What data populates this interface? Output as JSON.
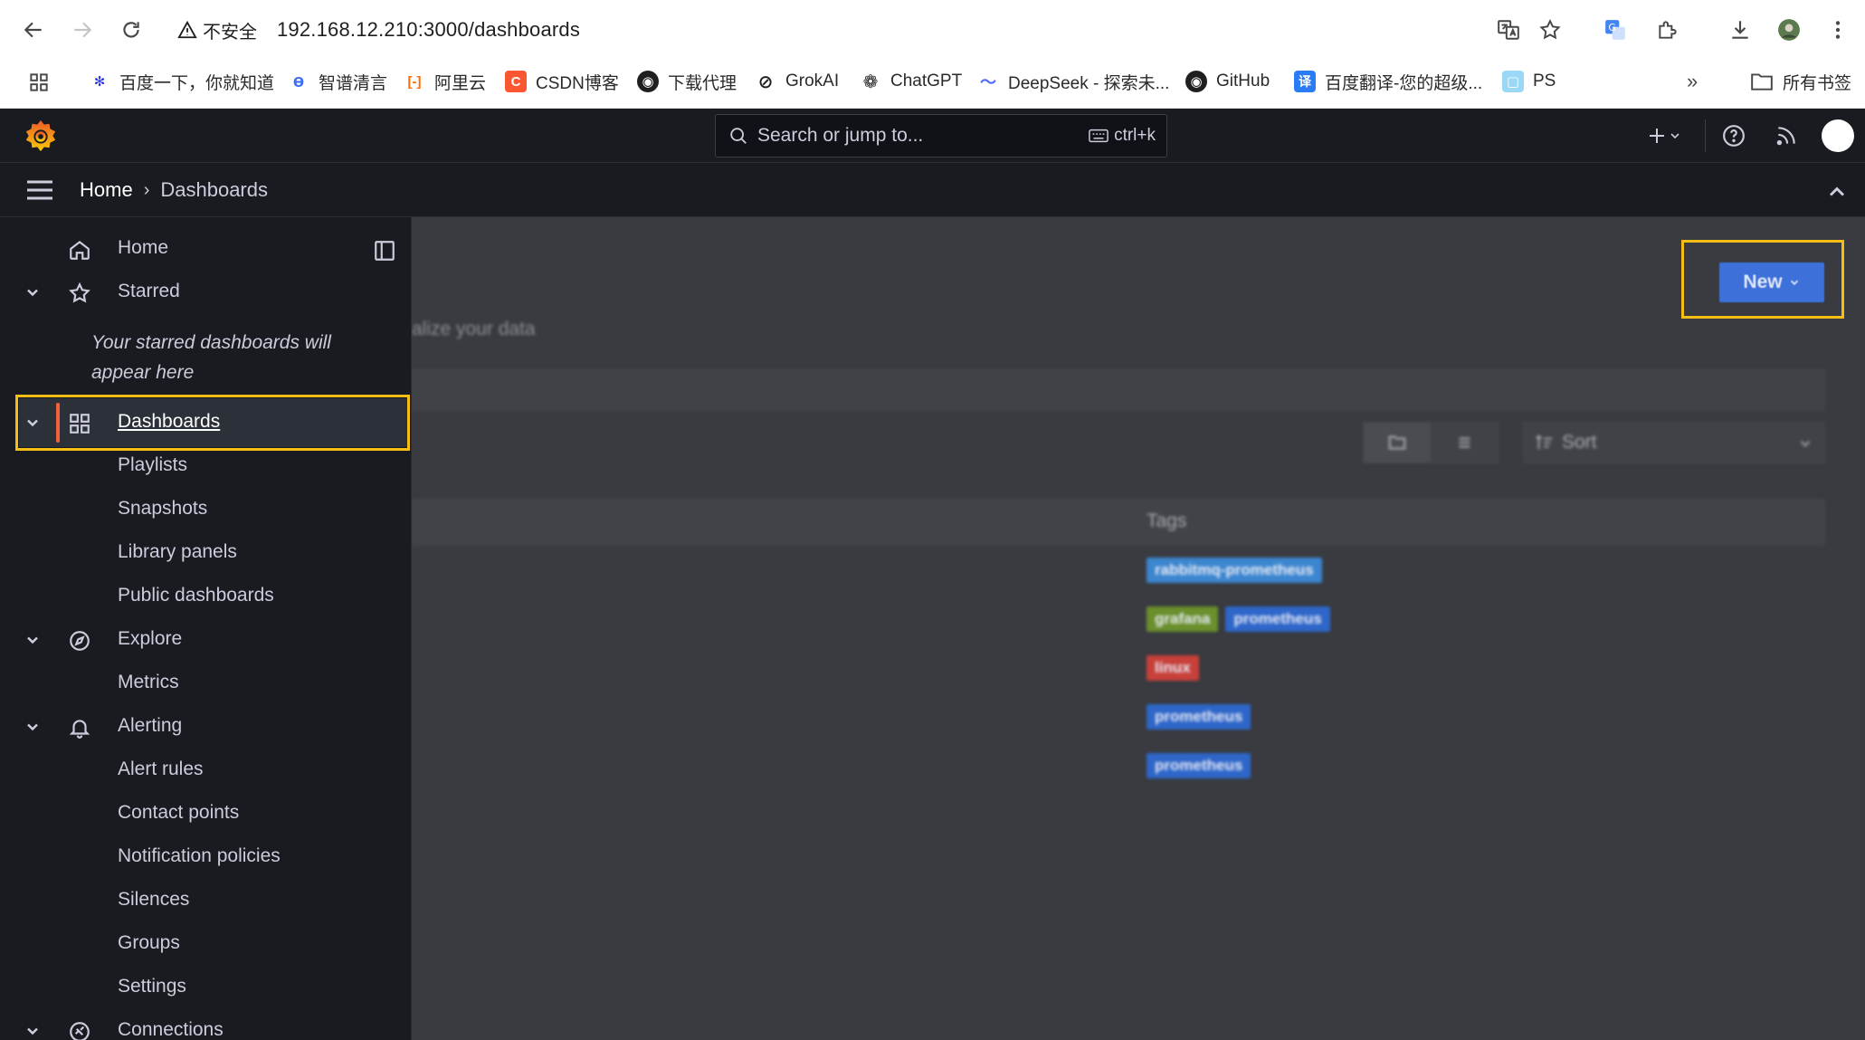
{
  "browser": {
    "security_label": "不安全",
    "url": "192.168.12.210:3000/dashboards",
    "bookmarks": [
      {
        "label": "百度一下，你就知道",
        "icon": "baidu-paw-icon",
        "color": "#2932e1"
      },
      {
        "label": "智谱清言",
        "icon": "zhipu-icon",
        "color": "#3b6ef6"
      },
      {
        "label": "阿里云",
        "icon": "aliyun-icon",
        "color": "#ff6a00"
      },
      {
        "label": "CSDN博客",
        "icon": "csdn-icon",
        "color": "#fc5531"
      },
      {
        "label": "下载代理",
        "icon": "github-icon",
        "color": "#1f1f1f"
      },
      {
        "label": "GrokAI",
        "icon": "grok-icon",
        "color": "#1f1f1f"
      },
      {
        "label": "ChatGPT",
        "icon": "openai-icon",
        "color": "#1f1f1f"
      },
      {
        "label": "DeepSeek - 探索未...",
        "icon": "deepseek-icon",
        "color": "#4d6bfe"
      },
      {
        "label": "GitHub",
        "icon": "github-icon",
        "color": "#1f1f1f"
      },
      {
        "label": "百度翻译-您的超级...",
        "icon": "baidu-translate-icon",
        "color": "#2a7bf6"
      },
      {
        "label": "PS",
        "icon": "ps-icon",
        "color": "#9ad8f5"
      }
    ],
    "overflow_label": "»",
    "all_bookmarks_label": "所有书签"
  },
  "grafana": {
    "search_placeholder": "Search or jump to...",
    "search_shortcut": "ctrl+k",
    "breadcrumb": {
      "home": "Home",
      "separator": "›",
      "current": "Dashboards"
    }
  },
  "sidebar": {
    "items": [
      {
        "label": "Home",
        "icon": "home-icon"
      },
      {
        "label": "Starred",
        "icon": "star-icon"
      },
      {
        "label": "Dashboards",
        "icon": "dashboards-grid-icon"
      },
      {
        "label": "Playlists"
      },
      {
        "label": "Snapshots"
      },
      {
        "label": "Library panels"
      },
      {
        "label": "Public dashboards"
      },
      {
        "label": "Explore",
        "icon": "compass-icon"
      },
      {
        "label": "Metrics"
      },
      {
        "label": "Alerting",
        "icon": "bell-icon"
      },
      {
        "label": "Alert rules"
      },
      {
        "label": "Contact points"
      },
      {
        "label": "Notification policies"
      },
      {
        "label": "Silences"
      },
      {
        "label": "Groups"
      },
      {
        "label": "Settings"
      },
      {
        "label": "Connections",
        "icon": "connections-icon"
      }
    ],
    "starred_empty": "Your starred dashboards will appear here",
    "active_item": "Dashboards"
  },
  "main": {
    "subtitle": "alize your data",
    "sort_label": "Sort",
    "tags_header": "Tags",
    "new_button_label": "New",
    "tag_rows": [
      [
        {
          "label": "rabbitmq-prometheus",
          "color": "#3c86d0"
        }
      ],
      [
        {
          "label": "grafana",
          "color": "#6a8f2c"
        },
        {
          "label": "prometheus",
          "color": "#2e66c9"
        }
      ],
      [
        {
          "label": "linux",
          "color": "#c8403a"
        }
      ],
      [
        {
          "label": "prometheus",
          "color": "#2e66c9"
        }
      ],
      [
        {
          "label": "prometheus",
          "color": "#2e66c9"
        }
      ]
    ]
  },
  "colors": {
    "highlight": "#f6be15",
    "active_indicator": "#f55f3e",
    "primary_button": "#3d71d9"
  }
}
